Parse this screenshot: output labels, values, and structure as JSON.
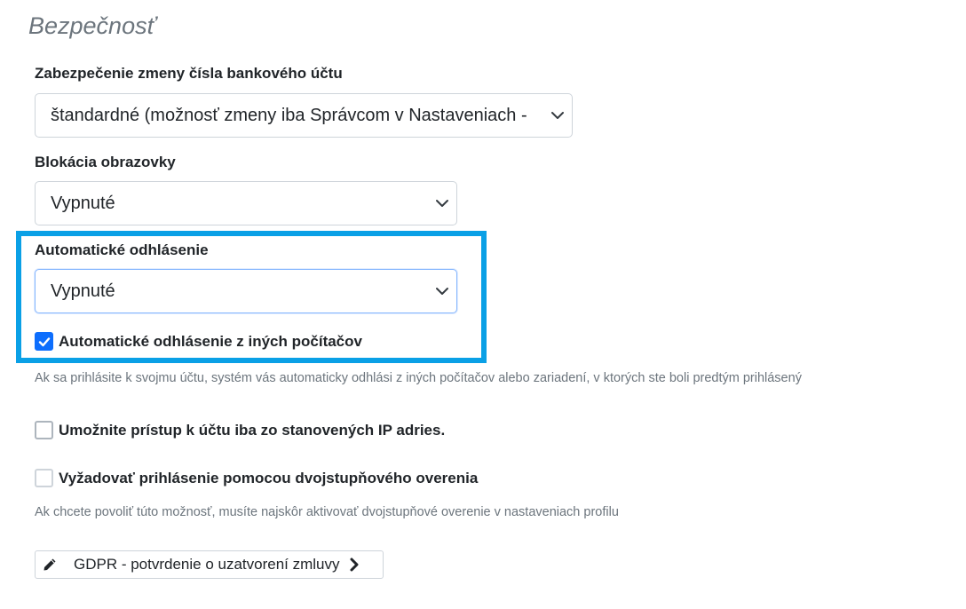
{
  "section": {
    "title": "Bezpečnosť"
  },
  "bank_account": {
    "label": "Zabezpečenie zmeny čísla bankového účtu",
    "selected": "štandardné (možnosť zmeny iba Správcom v Nastaveniach - "
  },
  "screen_lock": {
    "label": "Blokácia obrazovky",
    "selected": "Vypnuté"
  },
  "auto_logout": {
    "label": "Automatické odhlásenie",
    "selected": "Vypnuté",
    "other_computers_label": "Automatické odhlásenie z iných počítačov",
    "other_computers_checked": true,
    "help": "Ak sa prihlásite k svojmu účtu, systém vás automaticky odhlási z iných počítačov alebo zariadení, v ktorých ste boli predtým prihlásený"
  },
  "ip_restriction": {
    "label": "Umožnite prístup k účtu iba zo stanovených IP adries.",
    "checked": false
  },
  "two_factor": {
    "label": "Vyžadovať prihlásenie pomocou dvojstupňového overenia",
    "checked": false,
    "disabled": true,
    "help": "Ak chcete povoliť túto možnosť, musíte najskôr aktivovať dvojstupňové overenie v nastaveniach profilu"
  },
  "gdpr": {
    "label": "GDPR - potvrdenie o uzatvorení zmluvy"
  },
  "icons": {
    "select_arrow": "chevron-down-icon",
    "check": "checkmark-icon",
    "edit": "pencil-icon",
    "forward": "chevron-right-icon"
  },
  "colors": {
    "highlight": "#0aa0e6",
    "checkbox_checked": "#0d6efd",
    "muted_text": "#6c757d"
  }
}
